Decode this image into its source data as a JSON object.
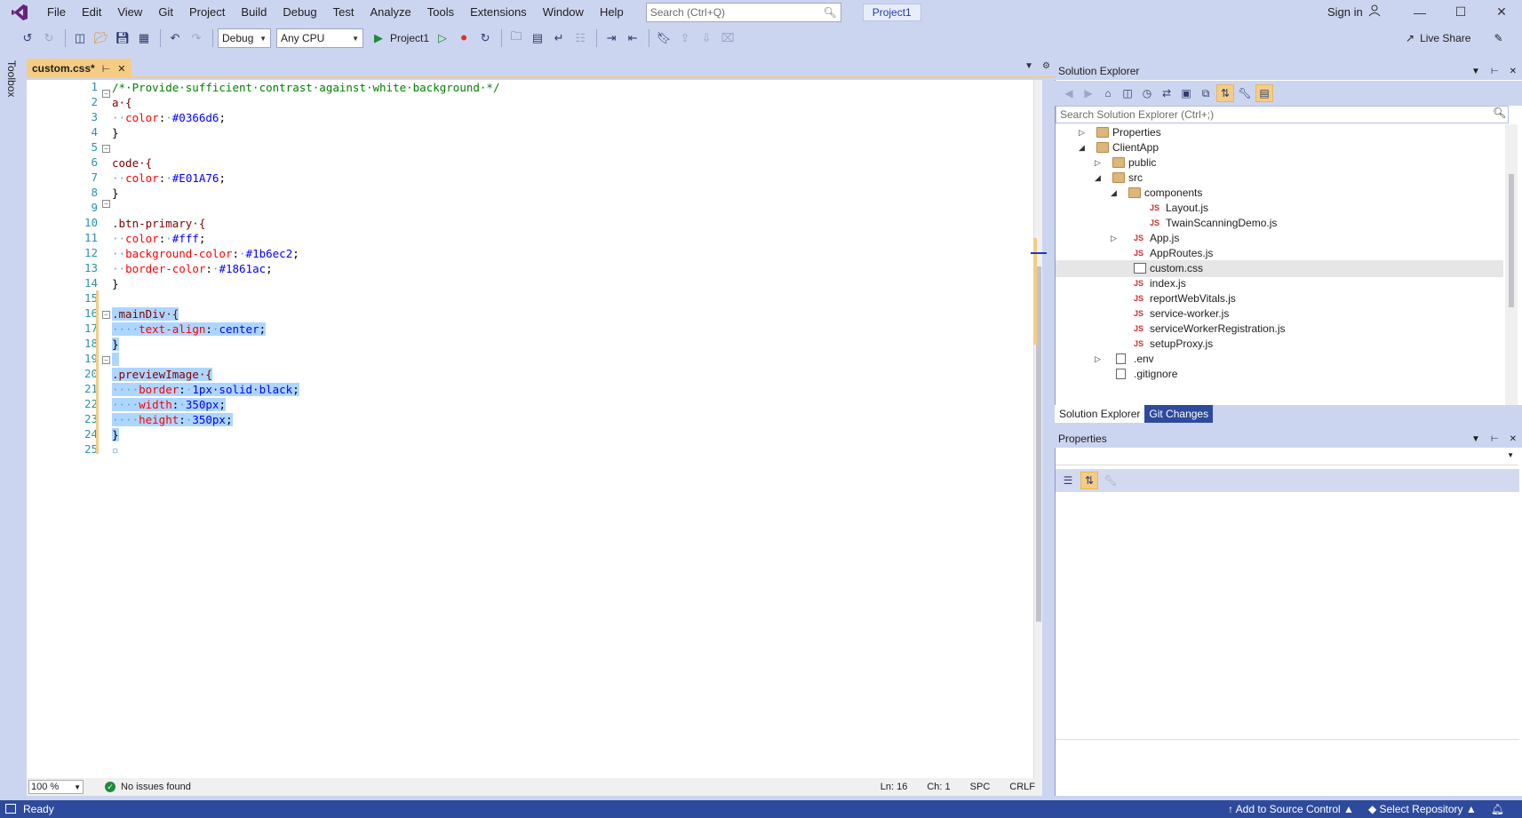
{
  "menu": {
    "items": [
      "File",
      "Edit",
      "View",
      "Git",
      "Project",
      "Build",
      "Debug",
      "Test",
      "Analyze",
      "Tools",
      "Extensions",
      "Window",
      "Help"
    ],
    "search_placeholder": "Search (Ctrl+Q)",
    "project_name": "Project1",
    "sign_in": "Sign in"
  },
  "toolbar": {
    "config": "Debug",
    "platform": "Any CPU",
    "run_target": "Project1",
    "live_share": "Live Share"
  },
  "toolbox": {
    "label": "Toolbox"
  },
  "editor": {
    "tab_title": "custom.css*",
    "line_numbers": [
      "1",
      "2",
      "3",
      "4",
      "5",
      "6",
      "7",
      "8",
      "9",
      "10",
      "11",
      "12",
      "13",
      "14",
      "15",
      "16",
      "17",
      "18",
      "19",
      "20",
      "21",
      "22",
      "23",
      "24",
      "25"
    ],
    "code": {
      "l1": "/*·Provide·sufficient·contrast·against·white·background·*/",
      "l2_sel": "a·{",
      "l3_prop": "color",
      "l3_val": "#0366d6",
      "l6_sel": "code·{",
      "l7_prop": "color",
      "l7_val": "#E01A76",
      "l10_sel": ".btn-primary·{",
      "l11_prop": "color",
      "l11_val": "#fff",
      "l12_prop": "background-color",
      "l12_val": "#1b6ec2",
      "l13_prop": "border-color",
      "l13_val": "#1861ac",
      "l16_sel": ".mainDiv·{",
      "l17_prop": "text-align",
      "l17_val": "center",
      "l20_sel": ".previewImage·{",
      "l21_prop": "border",
      "l21_val": "1px·solid·black",
      "l22_prop": "width",
      "l22_val": "350px",
      "l23_prop": "height",
      "l23_val": "350px",
      "brace_close": "}"
    },
    "status": {
      "zoom": "100 %",
      "issues": "No issues found",
      "line": "Ln: 16",
      "col": "Ch: 1",
      "spc": "SPC",
      "eol": "CRLF"
    }
  },
  "solution_explorer": {
    "title": "Solution Explorer",
    "search_placeholder": "Search Solution Explorer (Ctrl+;)",
    "tree": [
      "Properties",
      "ClientApp",
      "public",
      "src",
      "components",
      "Layout.js",
      "TwainScanningDemo.js",
      "App.js",
      "AppRoutes.js",
      "custom.css",
      "index.js",
      "reportWebVitals.js",
      "service-worker.js",
      "serviceWorkerRegistration.js",
      "setupProxy.js",
      ".env",
      ".gitignore"
    ],
    "tabs": [
      "Solution Explorer",
      "Git Changes"
    ]
  },
  "properties": {
    "title": "Properties"
  },
  "statusbar": {
    "ready": "Ready",
    "source_control": "Add to Source Control",
    "repository": "Select Repository"
  },
  "colors": {
    "accent": "#2e4a9c",
    "chrome": "#ccd5f0",
    "tab_active": "#f5cc84",
    "selection": "#add6ff"
  }
}
